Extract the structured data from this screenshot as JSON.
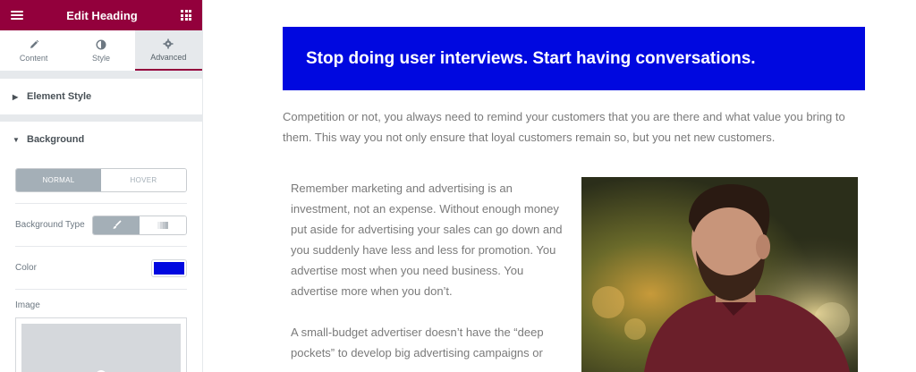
{
  "panel": {
    "title": "Edit Heading",
    "tabs": [
      {
        "label": "Content",
        "icon": "pencil-icon"
      },
      {
        "label": "Style",
        "icon": "contrast-icon"
      },
      {
        "label": "Advanced",
        "icon": "gear-icon"
      }
    ],
    "active_tab": "Advanced",
    "sections": {
      "element_style": "Element Style",
      "background": "Background"
    },
    "state_toggle": {
      "normal": "NORMAL",
      "hover": "HOVER",
      "selected": "NORMAL"
    },
    "background_type_label": "Background Type",
    "background_type_options": [
      "classic-brush-icon",
      "gradient-icon"
    ],
    "color_label": "Color",
    "color_value": "#0008e0",
    "image_label": "Image"
  },
  "content": {
    "heading": "Stop doing user interviews. Start having conversations.",
    "lead": "Competition or not, you always need to remind your customers that you are there and what value you bring to them. This way you not only ensure that loyal customers remain so, but you net new customers.",
    "paragraphs": [
      "Remember marketing and advertising is an investment, not an expense. Without enough money put aside for advertising your sales can go down and you suddenly have less and less for promotion. You advertise most when you need business. You advertise more when you don’t.",
      "A small-budget advertiser doesn’t have the “deep pockets” to develop big advertising campaigns or"
    ]
  },
  "colors": {
    "brand": "#93003c",
    "banner": "#0008e0",
    "body_text": "#7a7a7a"
  }
}
